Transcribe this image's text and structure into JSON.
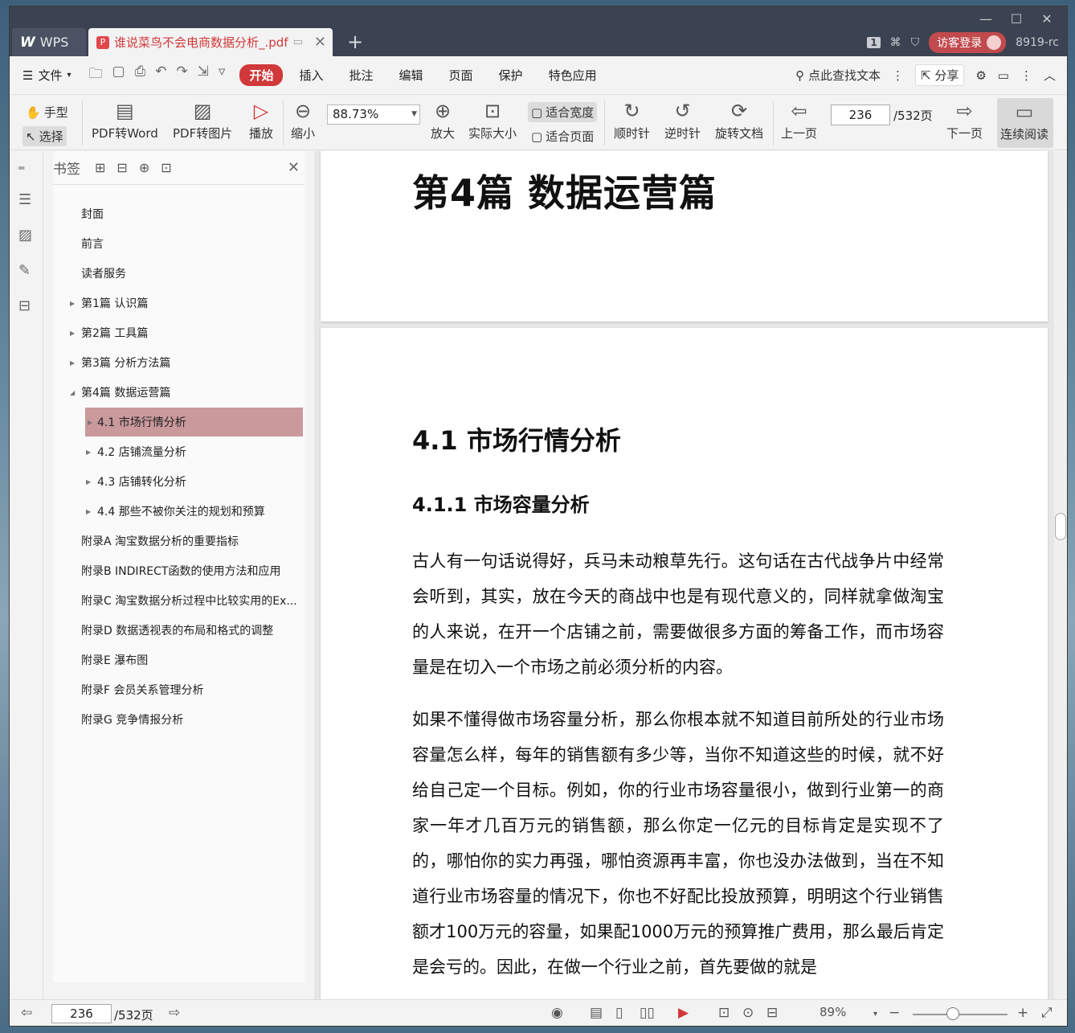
{
  "titlebar": {
    "wps_tab": "WPS",
    "doc_tab": "谁说菜鸟不会电商数据分析_.pdf",
    "badge": "1",
    "login": "访客登录",
    "version": "8919-rc"
  },
  "menubar": {
    "file": "文件",
    "menus": [
      "开始",
      "插入",
      "批注",
      "编辑",
      "页面",
      "保护",
      "特色应用"
    ],
    "search": "点此查找文本",
    "share": "分享"
  },
  "ribbon": {
    "hand": "手型",
    "select": "选择",
    "pdf2word": "PDF转Word",
    "pdf2img": "PDF转图片",
    "play": "播放",
    "zoom_out": "缩小",
    "zoom_value": "88.73%",
    "zoom_in": "放大",
    "actual": "实际大小",
    "fit_width": "适合宽度",
    "fit_page": "适合页面",
    "cw": "顺时针",
    "ccw": "逆时针",
    "rotate": "旋转文档",
    "prev": "上一页",
    "page": "236",
    "total": "/532页",
    "next": "下一页",
    "continuous": "连续阅读"
  },
  "bookmarks": {
    "title": "书签",
    "items": [
      {
        "label": "封面"
      },
      {
        "label": "前言"
      },
      {
        "label": "读者服务"
      },
      {
        "label": "第1篇 认识篇"
      },
      {
        "label": "第2篇 工具篇"
      },
      {
        "label": "第3篇 分析方法篇"
      },
      {
        "label": "第4篇 数据运营篇"
      },
      {
        "label": "4.1 市场行情分析"
      },
      {
        "label": "4.2 店铺流量分析"
      },
      {
        "label": "4.3 店铺转化分析"
      },
      {
        "label": "4.4 那些不被你关注的规划和预算"
      },
      {
        "label": "附录A 淘宝数据分析的重要指标"
      },
      {
        "label": "附录B INDIRECT函数的使用方法和应用"
      },
      {
        "label": "附录C 淘宝数据分析过程中比较实用的Ex..."
      },
      {
        "label": "附录D 数据透视表的布局和格式的调整"
      },
      {
        "label": "附录E 瀑布图"
      },
      {
        "label": "附录F 会员关系管理分析"
      },
      {
        "label": "附录G 竞争情报分析"
      }
    ]
  },
  "document": {
    "part_title": "第4篇 数据运营篇",
    "h1": "4.1 市场行情分析",
    "h2": "4.1.1 市场容量分析",
    "p1": "古人有一句话说得好，兵马未动粮草先行。这句话在古代战争片中经常会听到，其实，放在今天的商战中也是有现代意义的，同样就拿做淘宝的人来说，在开一个店铺之前，需要做很多方面的筹备工作，而市场容量是在切入一个市场之前必须分析的内容。",
    "p2": "如果不懂得做市场容量分析，那么你根本就不知道目前所处的行业市场容量怎么样，每年的销售额有多少等，当你不知道这些的时候，就不好给自己定一个目标。例如，你的行业市场容量很小，做到行业第一的商家一年才几百万元的销售额，那么你定一亿元的目标肯定是实现不了的，哪怕你的实力再强，哪怕资源再丰富，你也没办法做到，当在不知道行业市场容量的情况下，你也不好配比投放预算，明明这个行业销售额才100万元的容量，如果配1000万元的预算推广费用，那么最后肯定是会亏的。因此，在做一个行业之前，首先要做的就是"
  },
  "status": {
    "page": "236",
    "total": "/532页",
    "zoom": "89%"
  }
}
